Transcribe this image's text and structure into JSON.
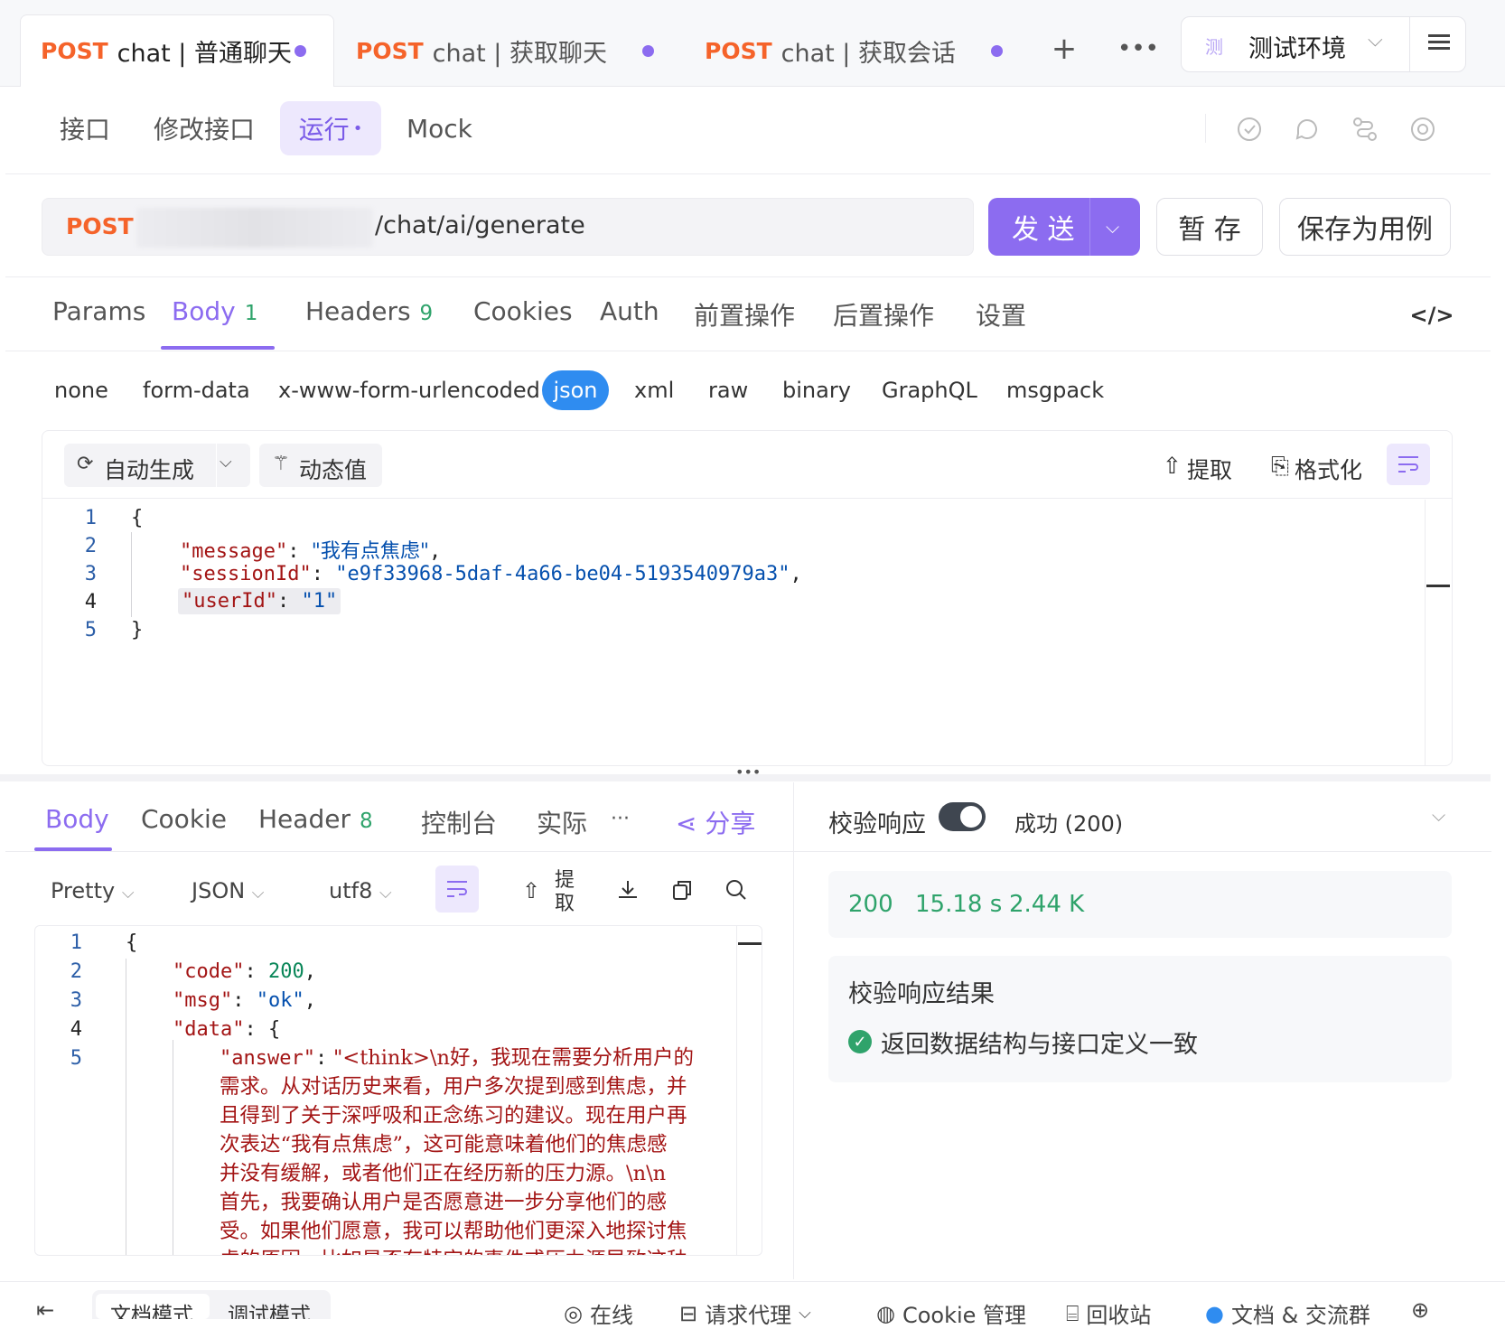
{
  "tabs": [
    {
      "method": "POST",
      "title": "chat | 普通聊天"
    },
    {
      "method": "POST",
      "title": "chat | 获取聊天..."
    },
    {
      "method": "POST",
      "title": "chat | 获取会话..."
    }
  ],
  "environment": {
    "badge": "测",
    "label": "测试环境"
  },
  "subnav": {
    "items": [
      "接口",
      "修改接口",
      "运行",
      "Mock"
    ],
    "active": "运行"
  },
  "request": {
    "method": "POST",
    "url_path": "/chat/ai/generate",
    "send_label": "发 送",
    "save_label": "暂 存",
    "save_case_label": "保存为用例"
  },
  "param_tabs": [
    {
      "label": "Params"
    },
    {
      "label": "Body",
      "count": "1"
    },
    {
      "label": "Headers",
      "count": "9"
    },
    {
      "label": "Cookies"
    },
    {
      "label": "Auth"
    },
    {
      "label": "前置操作"
    },
    {
      "label": "后置操作"
    },
    {
      "label": "设置"
    }
  ],
  "body_types": [
    "none",
    "form-data",
    "x-www-form-urlencoded",
    "json",
    "xml",
    "raw",
    "binary",
    "GraphQL",
    "msgpack"
  ],
  "editor_toolbar": {
    "auto_gen": "自动生成",
    "dynamic": "动态值",
    "extract": "提取",
    "format": "格式化"
  },
  "request_body": {
    "line_numbers": [
      "1",
      "2",
      "3",
      "4",
      "5"
    ],
    "open": "{",
    "close": "}",
    "message_key": "\"message\"",
    "message_val": "\"我有点焦虑\"",
    "session_key": "\"sessionId\"",
    "session_val": "\"e9f33968-5daf-4a66-be04-5193540979a3\"",
    "user_key": "\"userId\"",
    "user_val": "\"1\""
  },
  "response_tabs": {
    "body": "Body",
    "cookie": "Cookie",
    "header": "Header",
    "header_count": "8",
    "console": "控制台",
    "actual": "实际",
    "more": "···",
    "share": "分享"
  },
  "response_toolbar": {
    "pretty": "Pretty",
    "format": "JSON",
    "encoding": "utf8",
    "extract": "提取"
  },
  "response_body": {
    "line_numbers": [
      "1",
      "2",
      "3",
      "4",
      "5"
    ],
    "open": "{",
    "code_key": "\"code\"",
    "code_val": "200",
    "msg_key": "\"msg\"",
    "msg_val": "\"ok\"",
    "data_key": "\"data\"",
    "answer_key": "\"answer\"",
    "answer_lines": [
      "\"<think>\\n好，我现在需要分析用户的",
      "需求。从对话历史来看，用户多次提到感到焦虑，并",
      "且得到了关于深呼吸和正念练习的建议。现在用户再",
      "次表达“我有点焦虑”，这可能意味着他们的焦虑感",
      "并没有缓解，或者他们正在经历新的压力源。\\n\\n",
      "首先，我要确认用户是否愿意进一步分享他们的感",
      "受。如果他们愿意，我可以帮助他们更深入地探讨焦",
      "虑的原因，比如是否有特定的事件或压力源导致这种"
    ]
  },
  "validation": {
    "label": "校验响应",
    "toggle_on": true,
    "status_text": "成功 (200)",
    "status_code": "200",
    "time": "15.18 s",
    "size": "2.44 K",
    "result_title": "校验响应结果",
    "result_msg": "返回数据结构与接口定义一致"
  },
  "footer": {
    "doc_mode": "文档模式",
    "debug_mode": "调试模式",
    "online": "在线",
    "proxy": "请求代理",
    "cookie": "Cookie 管理",
    "recycle": "回收站",
    "docs": "文档 & 交流群"
  },
  "colors": {
    "accent": "#8c6cf0",
    "method": "#f5632a",
    "json_pill": "#2f8cf0",
    "success": "#2fa36b"
  }
}
